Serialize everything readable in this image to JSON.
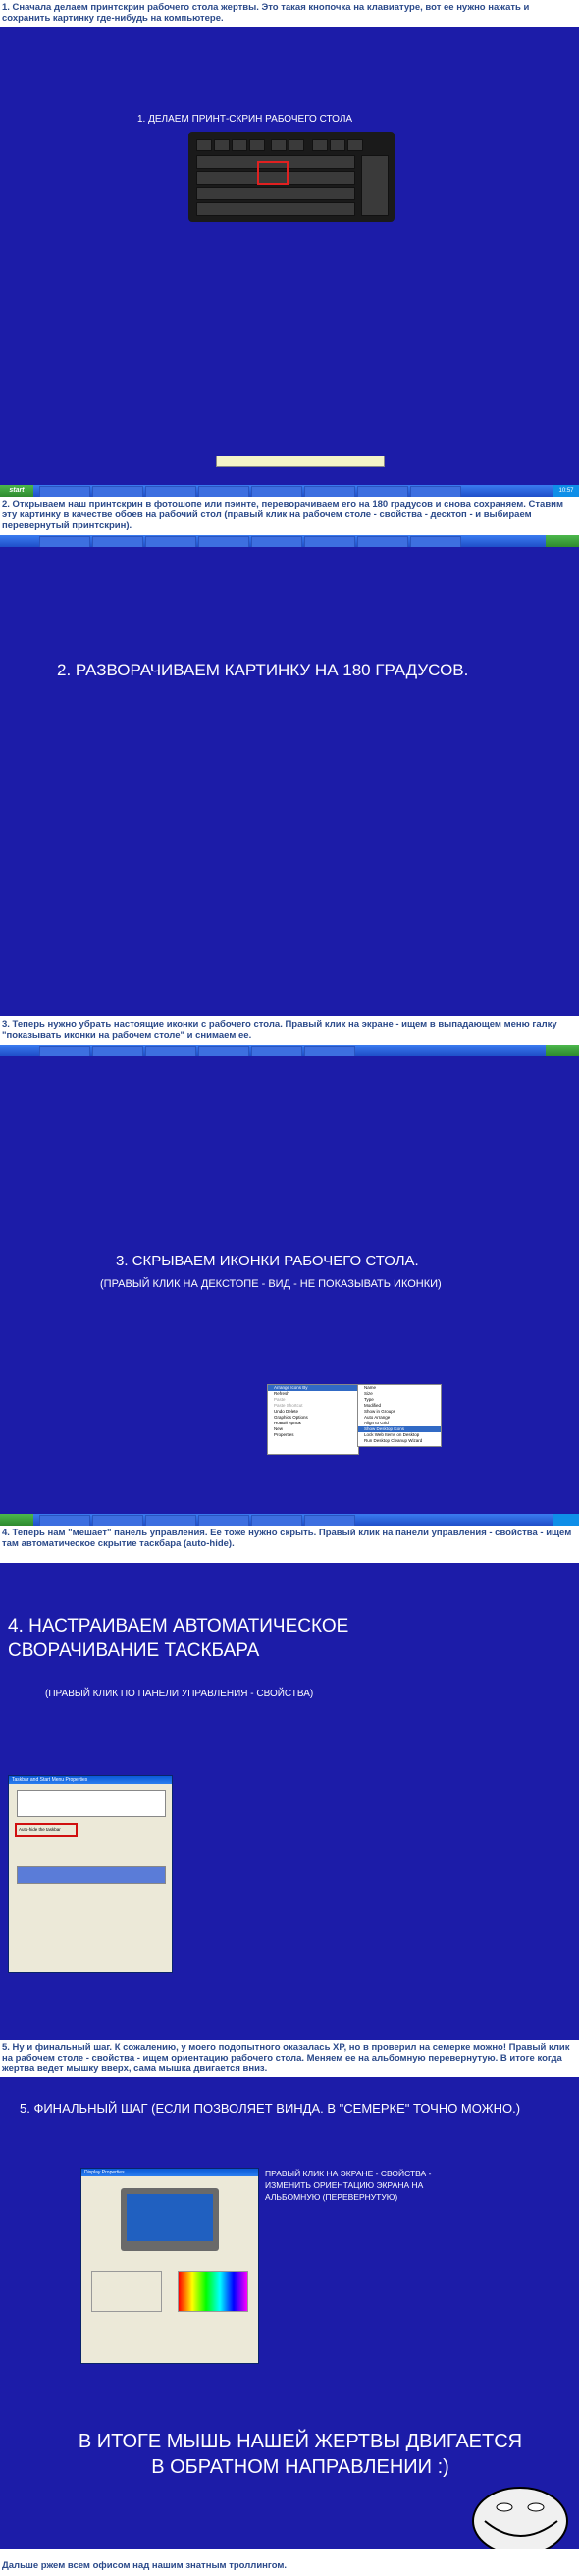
{
  "captions": {
    "c1": "1. Сначала делаем принтскрин рабочего стола жертвы. Это такая кнопочка на клавиатуре, вот ее нужно нажать и сохранить картинку где-нибудь на компьютере.",
    "c2": "2. Открываем наш принтскрин в фотошопе или пэинте, переворачиваем его на 180 градусов и снова сохраняем. Ставим эту картинку в качестве обоев на рабочий стол (правый клик на рабочем столе - свойства - десктоп - и выбираем перевернутый принтскрин).",
    "c3": "3. Теперь нужно убрать настоящие иконки с рабочего стола. Правый клик на экране - ищем в выпадающем меню галку \"показывать иконки на рабочем столе\" и снимаем ее.",
    "c4": "4. Теперь нам \"мешает\" панель управления. Ее тоже нужно скрыть. Правый клик на панели управления - свойства - ищем там автоматическое скрытие таскбара (auto-hide).",
    "c5": "5. Ну и финальный шаг. К сожалению, у моего подопытного оказалась XP, но в проверил на семерке можно! Правый клик на рабочем столе - свойства - ищем ориентацию рабочего стола. Меняем ее на альбомную перевернутую. В итоге когда жертва ведет мышку вверх, сама мышка двигается вниз.",
    "footer": "Дальше ржем всем офисом над нашим знатным троллингом."
  },
  "panel1": {
    "title": "1. ДЕЛАЕМ ПРИНТ-СКРИН РАБОЧЕГО СТОЛА"
  },
  "panel2": {
    "title": "2. РАЗВОРАЧИВАЕМ КАРТИНКУ НА 180 ГРАДУСОВ."
  },
  "panel3": {
    "title": "3. СКРЫВАЕМ ИКОНКИ РАБОЧЕГО СТОЛА.",
    "subtitle": "(ПРАВЫЙ КЛИК НА ДЕКСТОПЕ - ВИД - НЕ ПОКАЗЫВАТЬ ИКОНКИ)",
    "menu": [
      "Arrange Icons By",
      "Refresh",
      "Paste",
      "Paste Shortcut",
      "Undo Delete",
      "Graphics Options",
      "Новый ярлык",
      "New",
      "Properties"
    ],
    "submenu": [
      "Name",
      "Size",
      "Type",
      "Modified",
      "Show in Groups",
      "Auto Arrange",
      "Align to Grid",
      "Show Desktop Icons",
      "Lock Web Items on Desktop",
      "Run Desktop Cleanup Wizard"
    ]
  },
  "panel4": {
    "title": "4. НАСТРАИВАЕМ АВТОМАТИЧЕСКОЕ СВОРАЧИВАНИЕ ТАСКБАРА",
    "subtitle": "(ПРАВЫЙ КЛИК ПО ПАНЕЛИ УПРАВЛЕНИЯ - СВОЙСТВА)",
    "dialog_title": "Taskbar and Start Menu Properties",
    "autohide": "Auto-hide the taskbar"
  },
  "panel5": {
    "title": "5. ФИНАЛЬНЫЙ ШАГ (ЕСЛИ ПОЗВОЛЯЕТ ВИНДА. В \"СЕМЕРКЕ\" ТОЧНО МОЖНО.)",
    "note": "ПРАВЫЙ КЛИК НА ЭКРАНЕ - СВОЙСТВА - ИЗМЕНИТЬ ОРИЕНТАЦИЮ ЭКРАНА НА АЛЬБОМНУЮ (ПЕРЕВЕРНУТУЮ)",
    "dialog_title": "Display Properties",
    "result": "В ИТОГЕ МЫШЬ НАШЕЙ ЖЕРТВЫ ДВИГАЕТСЯ В ОБРАТНОМ НАПРАВЛЕНИИ :)"
  },
  "taskbar": {
    "start": "start",
    "clock": "10:57"
  }
}
